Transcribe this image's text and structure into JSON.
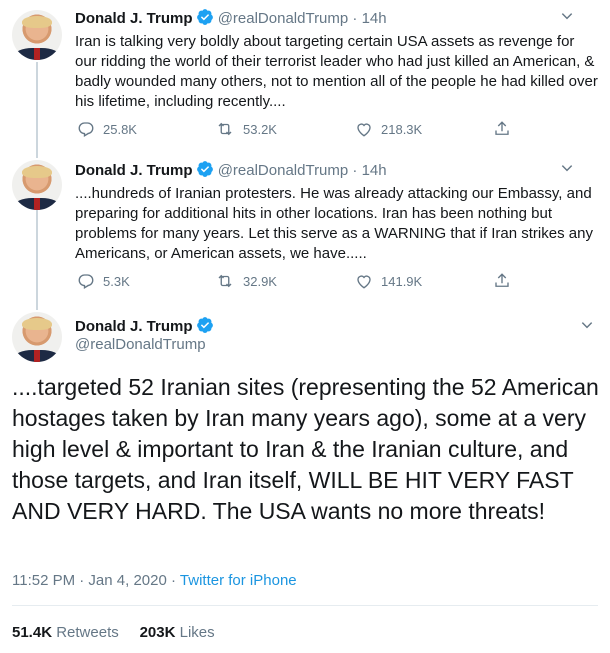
{
  "tweets": [
    {
      "name": "Donald J. Trump",
      "handle": "@realDonaldTrump",
      "separator": "·",
      "time": "14h",
      "text": "Iran is talking very boldly about targeting certain USA assets as revenge for our ridding the world of their terrorist leader who had just killed an American, & badly wounded many others, not to mention all of the people he had killed over his lifetime, including recently....",
      "replies": "25.8K",
      "retweets": "53.2K",
      "likes": "218.3K"
    },
    {
      "name": "Donald J. Trump",
      "handle": "@realDonaldTrump",
      "separator": "·",
      "time": "14h",
      "text": "....hundreds of Iranian protesters. He was already attacking our Embassy, and preparing for additional hits in other locations. Iran has been nothing but problems for many years. Let this serve as a WARNING that if Iran strikes any Americans, or American assets, we have.....",
      "replies": "5.3K",
      "retweets": "32.9K",
      "likes": "141.9K"
    }
  ],
  "main": {
    "name": "Donald J. Trump",
    "handle": "@realDonaldTrump",
    "text": "....targeted 52 Iranian sites (representing the 52 American hostages taken by Iran many years ago), some at a very high level & important to Iran &  the Iranian culture, and those targets, and Iran itself, WILL BE HIT VERY FAST AND VERY HARD. The USA wants no more threats!",
    "timestamp": "11:52 PM · Jan 4, 2020",
    "separator": "·",
    "source": "Twitter for iPhone",
    "retweet_count": "51.4K",
    "retweet_label": "Retweets",
    "like_count": "203K",
    "like_label": "Likes"
  },
  "icons": {
    "verified": "verified-badge-icon",
    "chevron": "chevron-down-icon",
    "reply": "reply-icon",
    "retweet": "retweet-icon",
    "like": "like-icon",
    "share": "share-icon"
  },
  "colors": {
    "accent": "#1da1f2",
    "link": "#1b95e0",
    "muted": "#657786"
  }
}
